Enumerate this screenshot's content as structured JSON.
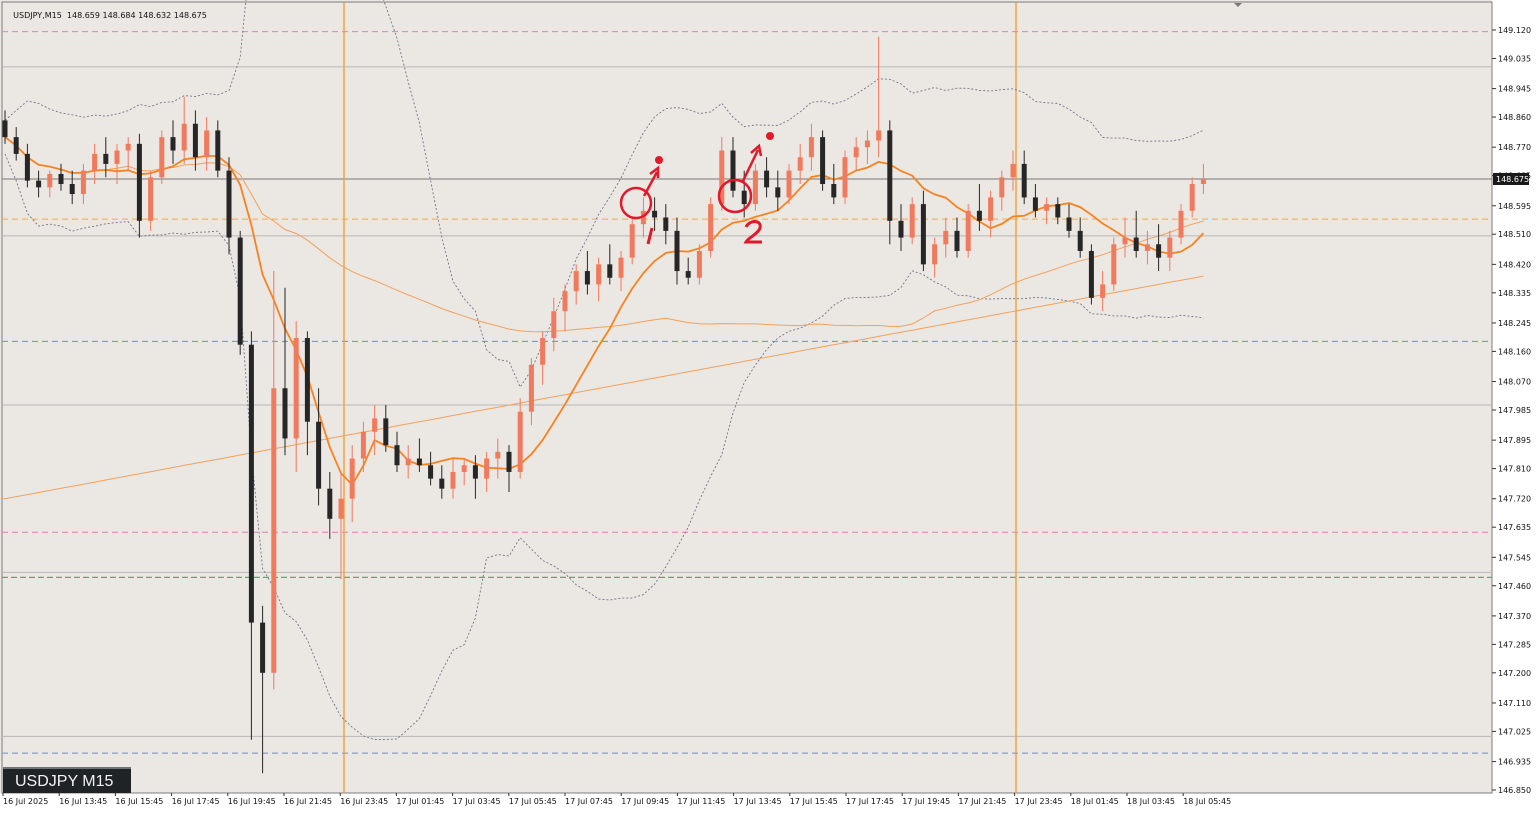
{
  "header": {
    "symbol_tf": "USDJPY,M15",
    "quote": "148.659 148.684 148.632 148.675"
  },
  "badge": {
    "label": "USDJPY M15"
  },
  "colors": {
    "background": "#ebe7e3",
    "bull_candle": "#f07a5e",
    "bear_candle": "#262626",
    "ma_fast": "#f78320",
    "ma_slow": "#f3a15c",
    "bollinger": "#6f7586",
    "session_line": "#f59a23",
    "pink_level": "#e87fb4",
    "blue_level": "#6f8fc0",
    "green_level": "#6aa07a",
    "orange_level": "#f5a94a",
    "marker": "#e0192b"
  },
  "chart_data": {
    "type": "candlestick",
    "symbol": "USDJPY",
    "timeframe": "M15",
    "ylim": [
      146.835,
      149.165
    ],
    "y_ticks": [
      "149.120",
      "149.035",
      "148.945",
      "148.860",
      "148.770",
      "148.685",
      "148.595",
      "148.510",
      "148.420",
      "148.335",
      "148.245",
      "148.160",
      "148.070",
      "147.985",
      "147.895",
      "147.810",
      "147.720",
      "147.635",
      "147.545",
      "147.460",
      "147.370",
      "147.285",
      "147.200",
      "147.110",
      "147.025",
      "146.935",
      "146.850"
    ],
    "current_price": "148.675",
    "x_labels": [
      "16 Jul 2025",
      "16 Jul 13:45",
      "16 Jul 15:45",
      "16 Jul 17:45",
      "16 Jul 19:45",
      "16 Jul 21:45",
      "16 Jul 23:45",
      "17 Jul 01:45",
      "17 Jul 03:45",
      "17 Jul 05:45",
      "17 Jul 07:45",
      "17 Jul 09:45",
      "17 Jul 11:45",
      "17 Jul 13:45",
      "17 Jul 15:45",
      "17 Jul 17:45",
      "17 Jul 19:45",
      "17 Jul 21:45",
      "17 Jul 23:45",
      "18 Jul 01:45",
      "18 Jul 03:45",
      "18 Jul 05:45"
    ],
    "horizontal_levels": [
      {
        "price": 149.115,
        "style": "pink"
      },
      {
        "price": 149.01,
        "style": "gray"
      },
      {
        "price": 148.675,
        "style": "current"
      },
      {
        "price": 148.555,
        "style": "orange"
      },
      {
        "price": 148.505,
        "style": "gray"
      },
      {
        "price": 148.19,
        "style": "blue"
      },
      {
        "price": 148.0,
        "style": "gray"
      },
      {
        "price": 147.62,
        "style": "pink"
      },
      {
        "price": 147.5,
        "style": "gray"
      },
      {
        "price": 147.485,
        "style": "green"
      },
      {
        "price": 147.01,
        "style": "gray"
      },
      {
        "price": 146.96,
        "style": "blue"
      }
    ],
    "session_lines": [
      "16 Jul 23:45",
      "17 Jul 23:45"
    ],
    "candles": [
      [
        148.85,
        148.88,
        148.78,
        148.8
      ],
      [
        148.8,
        148.83,
        148.73,
        148.75
      ],
      [
        148.75,
        148.78,
        148.65,
        148.67
      ],
      [
        148.67,
        148.7,
        148.62,
        148.65
      ],
      [
        148.65,
        148.7,
        148.62,
        148.69
      ],
      [
        148.69,
        148.72,
        148.64,
        148.66
      ],
      [
        148.66,
        148.7,
        148.6,
        148.63
      ],
      [
        148.63,
        148.72,
        148.6,
        148.7
      ],
      [
        148.7,
        148.78,
        148.66,
        148.75
      ],
      [
        148.75,
        148.8,
        148.68,
        148.72
      ],
      [
        148.72,
        148.78,
        148.66,
        148.76
      ],
      [
        148.76,
        148.8,
        148.7,
        148.78
      ],
      [
        148.78,
        148.81,
        148.5,
        148.55
      ],
      [
        148.55,
        148.7,
        148.52,
        148.68
      ],
      [
        148.68,
        148.82,
        148.66,
        148.8
      ],
      [
        148.8,
        148.85,
        148.72,
        148.76
      ],
      [
        148.76,
        148.92,
        148.72,
        148.84
      ],
      [
        148.84,
        148.88,
        148.7,
        148.74
      ],
      [
        148.74,
        148.86,
        148.7,
        148.82
      ],
      [
        148.82,
        148.85,
        148.68,
        148.7
      ],
      [
        148.7,
        148.74,
        148.45,
        148.5
      ],
      [
        148.5,
        148.52,
        148.15,
        148.18
      ],
      [
        148.18,
        148.22,
        147.0,
        147.35
      ],
      [
        147.35,
        147.4,
        146.9,
        147.2
      ],
      [
        147.2,
        148.4,
        147.15,
        148.05
      ],
      [
        148.05,
        148.35,
        147.85,
        147.9
      ],
      [
        147.9,
        148.25,
        147.8,
        148.2
      ],
      [
        148.2,
        148.22,
        147.85,
        147.95
      ],
      [
        147.95,
        148.05,
        147.7,
        147.75
      ],
      [
        147.75,
        147.8,
        147.6,
        147.66
      ],
      [
        147.66,
        147.8,
        147.48,
        147.72
      ],
      [
        147.72,
        147.88,
        147.65,
        147.84
      ],
      [
        147.84,
        147.95,
        147.8,
        147.92
      ],
      [
        147.92,
        148.0,
        147.85,
        147.96
      ],
      [
        147.96,
        148.0,
        147.86,
        147.88
      ],
      [
        147.88,
        147.92,
        147.8,
        147.82
      ],
      [
        147.82,
        147.88,
        147.78,
        147.84
      ],
      [
        147.84,
        147.9,
        147.8,
        147.82
      ],
      [
        147.82,
        147.86,
        147.76,
        147.78
      ],
      [
        147.78,
        147.82,
        147.72,
        147.75
      ],
      [
        147.75,
        147.84,
        147.72,
        147.8
      ],
      [
        147.8,
        147.84,
        147.76,
        147.82
      ],
      [
        147.82,
        147.85,
        147.72,
        147.78
      ],
      [
        147.78,
        147.86,
        147.74,
        147.84
      ],
      [
        147.84,
        147.9,
        147.78,
        147.86
      ],
      [
        147.86,
        147.88,
        147.74,
        147.8
      ],
      [
        147.8,
        148.02,
        147.78,
        147.98
      ],
      [
        147.98,
        148.14,
        147.94,
        148.12
      ],
      [
        148.12,
        148.22,
        148.06,
        148.2
      ],
      [
        148.2,
        148.32,
        148.16,
        148.28
      ],
      [
        148.28,
        148.36,
        148.22,
        148.34
      ],
      [
        148.34,
        148.42,
        148.3,
        148.4
      ],
      [
        148.4,
        148.46,
        148.33,
        148.36
      ],
      [
        148.36,
        148.44,
        148.31,
        148.42
      ],
      [
        148.42,
        148.48,
        148.36,
        148.38
      ],
      [
        148.38,
        148.46,
        148.34,
        148.44
      ],
      [
        148.44,
        148.56,
        148.42,
        148.54
      ],
      [
        148.54,
        148.62,
        148.5,
        148.58
      ],
      [
        148.58,
        148.62,
        148.52,
        148.56
      ],
      [
        148.56,
        148.6,
        148.48,
        148.52
      ],
      [
        148.52,
        148.56,
        148.36,
        148.4
      ],
      [
        148.4,
        148.44,
        148.36,
        148.38
      ],
      [
        148.38,
        148.48,
        148.36,
        148.46
      ],
      [
        148.46,
        148.62,
        148.44,
        148.6
      ],
      [
        148.6,
        148.8,
        148.58,
        148.76
      ],
      [
        148.76,
        148.8,
        148.62,
        148.64
      ],
      [
        148.64,
        148.7,
        148.56,
        148.6
      ],
      [
        148.6,
        148.72,
        148.58,
        148.7
      ],
      [
        148.7,
        148.74,
        148.62,
        148.65
      ],
      [
        148.65,
        148.7,
        148.58,
        148.62
      ],
      [
        148.62,
        148.72,
        148.6,
        148.7
      ],
      [
        148.7,
        148.78,
        148.66,
        148.74
      ],
      [
        148.74,
        148.84,
        148.7,
        148.8
      ],
      [
        148.8,
        148.82,
        148.64,
        148.66
      ],
      [
        148.66,
        148.72,
        148.6,
        148.62
      ],
      [
        148.62,
        148.76,
        148.6,
        148.74
      ],
      [
        148.74,
        148.8,
        148.7,
        148.77
      ],
      [
        148.77,
        148.82,
        148.72,
        148.79
      ],
      [
        148.79,
        149.1,
        148.74,
        148.82
      ],
      [
        148.82,
        148.85,
        148.48,
        148.55
      ],
      [
        148.55,
        148.6,
        148.46,
        148.5
      ],
      [
        148.5,
        148.62,
        148.48,
        148.6
      ],
      [
        148.6,
        148.64,
        148.4,
        148.42
      ],
      [
        148.42,
        148.5,
        148.38,
        148.48
      ],
      [
        148.48,
        148.56,
        148.44,
        148.52
      ],
      [
        148.52,
        148.56,
        148.44,
        148.46
      ],
      [
        148.46,
        148.6,
        148.44,
        148.58
      ],
      [
        148.58,
        148.66,
        148.52,
        148.55
      ],
      [
        148.55,
        148.64,
        148.5,
        148.62
      ],
      [
        148.62,
        148.7,
        148.58,
        148.68
      ],
      [
        148.68,
        148.76,
        148.64,
        148.72
      ],
      [
        148.72,
        148.76,
        148.6,
        148.62
      ],
      [
        148.62,
        148.66,
        148.56,
        148.58
      ],
      [
        148.58,
        148.62,
        148.54,
        148.6
      ],
      [
        148.6,
        148.62,
        148.54,
        148.56
      ],
      [
        148.56,
        148.6,
        148.5,
        148.52
      ],
      [
        148.52,
        148.56,
        148.44,
        148.46
      ],
      [
        148.46,
        148.48,
        148.3,
        148.32
      ],
      [
        148.32,
        148.4,
        148.28,
        148.36
      ],
      [
        148.36,
        148.5,
        148.34,
        148.48
      ],
      [
        148.48,
        148.56,
        148.44,
        148.5
      ],
      [
        148.5,
        148.58,
        148.44,
        148.46
      ],
      [
        148.46,
        148.52,
        148.42,
        148.48
      ],
      [
        148.48,
        148.54,
        148.4,
        148.44
      ],
      [
        148.44,
        148.52,
        148.4,
        148.5
      ],
      [
        148.5,
        148.6,
        148.48,
        148.58
      ],
      [
        148.58,
        148.68,
        148.56,
        148.66
      ],
      [
        148.66,
        148.72,
        148.63,
        148.675
      ]
    ]
  }
}
